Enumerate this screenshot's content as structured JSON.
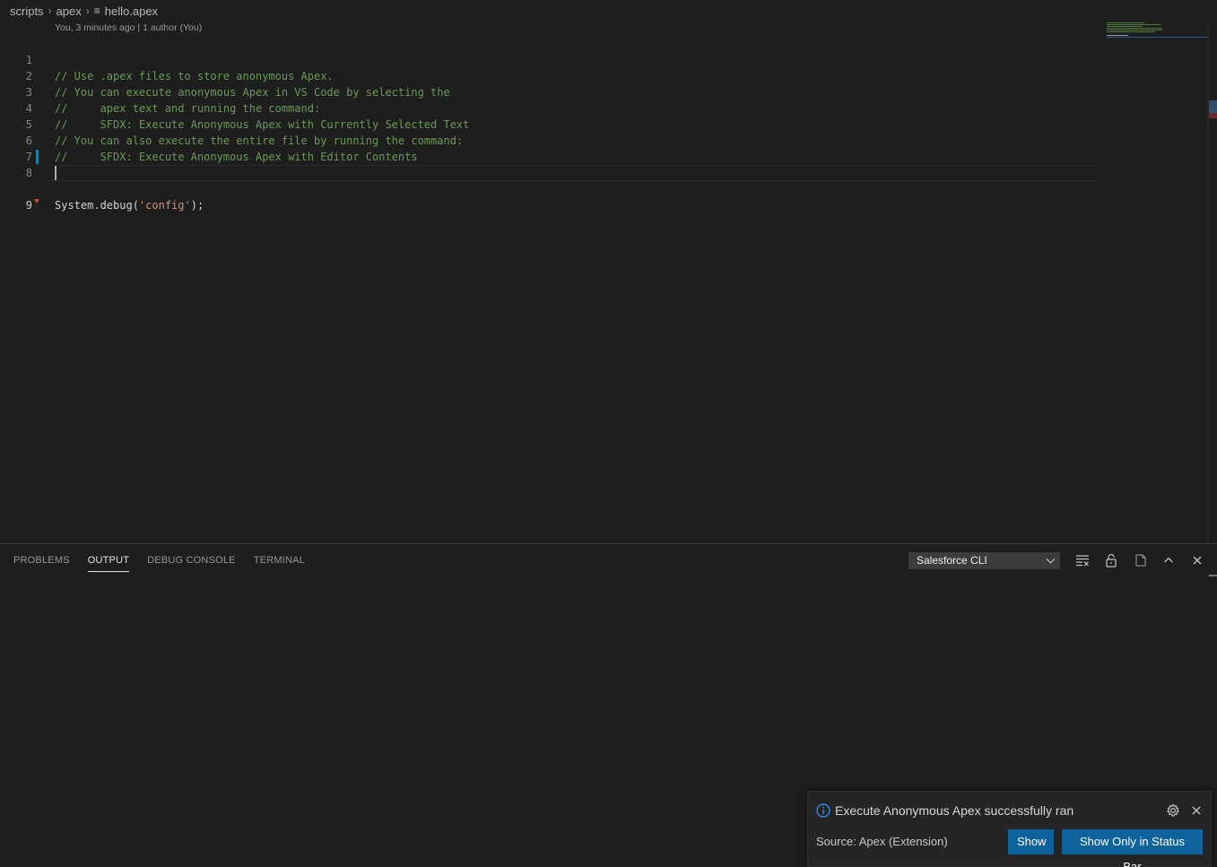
{
  "breadcrumb": {
    "items": [
      "scripts",
      "apex",
      "hello.apex"
    ]
  },
  "editor": {
    "blame": "You, 3 minutes ago | 1 author (You)",
    "lines": [
      {
        "num": "1",
        "text": "// Use .apex files to store anonymous Apex."
      },
      {
        "num": "2",
        "text": "// You can execute anonymous Apex in VS Code by selecting the"
      },
      {
        "num": "3",
        "text": "//     apex text and running the command:"
      },
      {
        "num": "4",
        "text": "//     SFDX: Execute Anonymous Apex with Currently Selected Text"
      },
      {
        "num": "5",
        "text": "// You can also execute the entire file by running the command:"
      },
      {
        "num": "6",
        "text": "//     SFDX: Execute Anonymous Apex with Editor Contents"
      },
      {
        "num": "7",
        "text": ""
      },
      {
        "num": "8",
        "code_pre": "System.debug(",
        "code_str": "'config'",
        "code_post": ");"
      },
      {
        "num": "9",
        "text": ""
      }
    ]
  },
  "panel": {
    "tabs": [
      "PROBLEMS",
      "OUTPUT",
      "DEBUG CONSOLE",
      "TERMINAL"
    ],
    "active_tab": "OUTPUT",
    "channel": "Salesforce CLI",
    "icons": [
      "clear-output-icon",
      "lock-scroll-icon",
      "open-log-icon",
      "maximize-panel-icon",
      "close-panel-icon"
    ]
  },
  "notification": {
    "message": "Execute Anonymous Apex successfully ran",
    "source": "Source: Apex (Extension)",
    "show_label": "Show",
    "status_bar_label": "Show Only in Status Bar"
  },
  "colors": {
    "comment": "#6a9955",
    "string": "#ce9178",
    "button": "#0e639c",
    "modified_gutter": "#1b81a8"
  }
}
